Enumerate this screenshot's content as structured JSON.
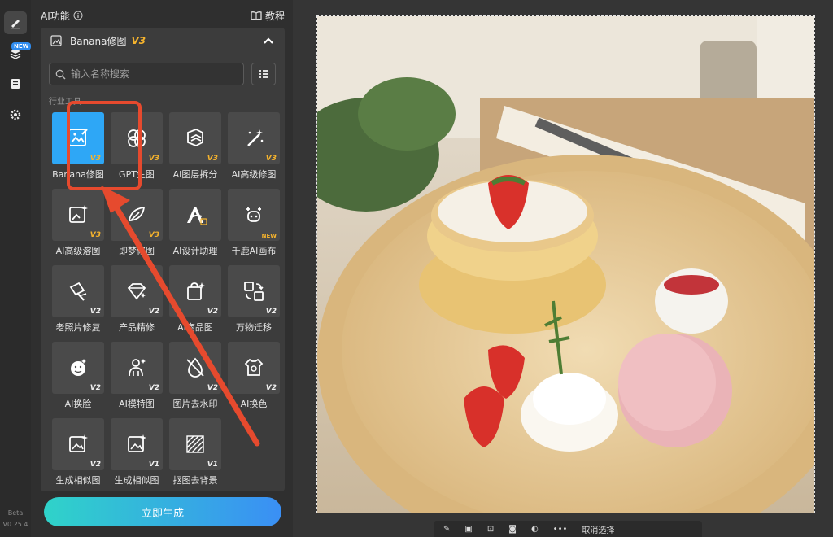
{
  "rail": {
    "new_badge": "NEW",
    "version_beta": "Beta",
    "version_num": "V0.25.4",
    "icons": [
      "pen-icon",
      "layers-icon",
      "document-icon",
      "settings-icon"
    ]
  },
  "panel": {
    "title": "AI功能",
    "tutorial_label": "教程"
  },
  "card": {
    "title": "Banana修图",
    "version": "V3",
    "search_placeholder": "输入名称搜索",
    "section_label": "行业工具"
  },
  "tools": [
    {
      "label": "Banana修图",
      "version": "V3",
      "icon": "image-edit-icon",
      "selected": true
    },
    {
      "label": "GPT生图",
      "version": "V3",
      "icon": "gpt-knot-icon"
    },
    {
      "label": "AI图层拆分",
      "version": "V3",
      "icon": "layer-split-icon"
    },
    {
      "label": "AI高级修图",
      "version": "V3",
      "icon": "magic-wand-icon"
    },
    {
      "label": "AI高级溶图",
      "version": "V3",
      "icon": "image-sparkle-icon"
    },
    {
      "label": "即梦修图",
      "version": "V3",
      "icon": "leaf-brush-icon"
    },
    {
      "label": "AI设计助理",
      "version": "",
      "icon": "letter-a-icon"
    },
    {
      "label": "千鹿AI画布",
      "version": "NEW",
      "icon": "deer-icon"
    },
    {
      "label": "老照片修复",
      "version": "V2",
      "icon": "photo-repair-icon"
    },
    {
      "label": "产品精修",
      "version": "V2",
      "icon": "diamond-icon"
    },
    {
      "label": "AI商品图",
      "version": "V2",
      "icon": "shopping-bag-icon"
    },
    {
      "label": "万物迁移",
      "version": "V2",
      "icon": "transfer-icon"
    },
    {
      "label": "AI换脸",
      "version": "V2",
      "icon": "face-icon"
    },
    {
      "label": "AI模特图",
      "version": "V2",
      "icon": "model-person-icon"
    },
    {
      "label": "图片去水印",
      "version": "V2",
      "icon": "watermark-remove-icon"
    },
    {
      "label": "AI换色",
      "version": "V2",
      "icon": "palette-shirt-icon"
    },
    {
      "label": "生成相似图",
      "version": "V2",
      "icon": "similar-image-icon"
    },
    {
      "label": "生成相似图",
      "version": "V1",
      "icon": "similar-image-icon"
    },
    {
      "label": "抠图去背景",
      "version": "V1",
      "icon": "remove-bg-icon"
    }
  ],
  "generate_button": "立即生成",
  "bottom_bar": {
    "deselect_label": "取消选择"
  },
  "colors": {
    "accent_blue": "#2ea7f6",
    "version_gold": "#f5b32d",
    "highlight_red": "#e64a2e"
  }
}
